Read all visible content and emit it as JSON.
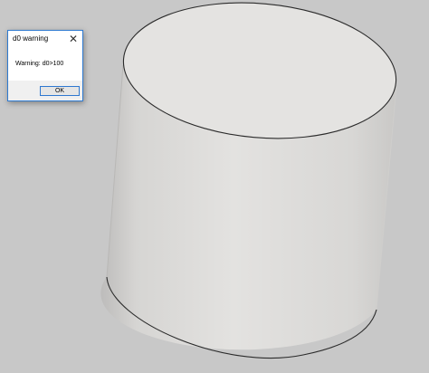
{
  "dialog": {
    "title": "d0 warning",
    "close_label": "✕",
    "message": "Warning: d0>100",
    "ok_label": "OK"
  },
  "viewport": {
    "background_color": "#c8c8c8",
    "shape": "cylinder",
    "shape_color": "#e2e0df",
    "edge_color": "#333333"
  }
}
